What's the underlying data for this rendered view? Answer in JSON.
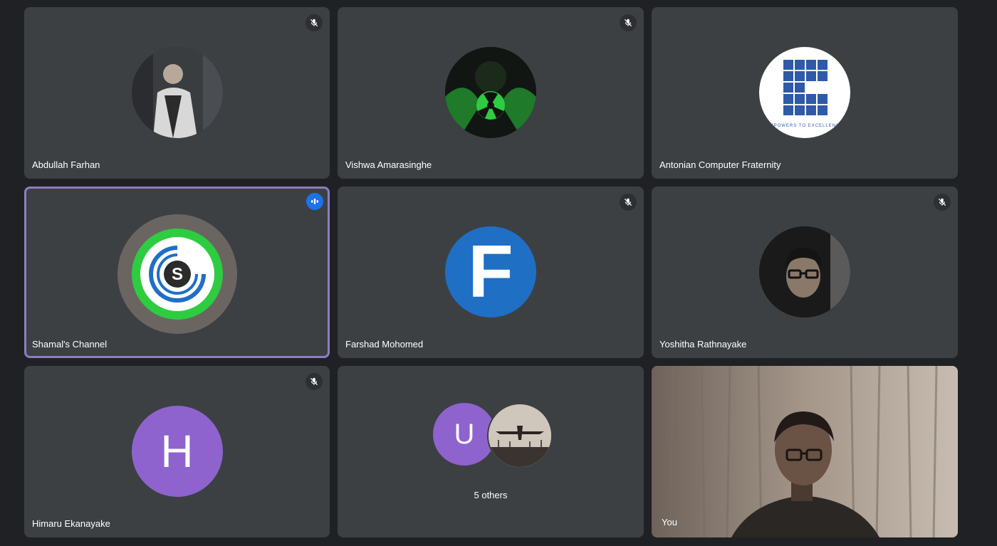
{
  "participants": [
    {
      "name": "Abdullah Farhan",
      "muted": true,
      "avatar": "photo-boy-standing"
    },
    {
      "name": "Vishwa Amarasinghe",
      "muted": true,
      "avatar": "radiation-mask-art"
    },
    {
      "name": "Antonian Computer Fraternity",
      "muted": false,
      "avatar": "logo-e-excellence",
      "logo_text": "EMPOWERS TO EXCELLENCE"
    },
    {
      "name": "Shamal's Channel",
      "speaking": true,
      "avatar": "logo-s-ring"
    },
    {
      "name": "Farshad Mohomed",
      "muted": true,
      "avatar": "letter-f",
      "letter": "F"
    },
    {
      "name": "Yoshitha Rathnayake",
      "muted": true,
      "avatar": "photo-boy-glasses"
    },
    {
      "name": "Himaru Ekanayake",
      "muted": true,
      "avatar": "letter-h",
      "letter": "H"
    },
    {
      "others_label": "5 others",
      "others_letter": "U",
      "others_avatar": "photo-airplane"
    },
    {
      "name": "You",
      "self_view": true
    }
  ],
  "colors": {
    "background": "#202124",
    "tile": "#3c4043",
    "active_border": "#8e7cc3",
    "speaking_badge": "#1a73e8",
    "letter_avatar_purple": "#8e63ce",
    "letter_avatar_blue": "#1f6fc5",
    "logo_green": "#2ecc40"
  },
  "icons": {
    "muted": "mic-off-icon",
    "speaking": "audio-level-icon"
  }
}
